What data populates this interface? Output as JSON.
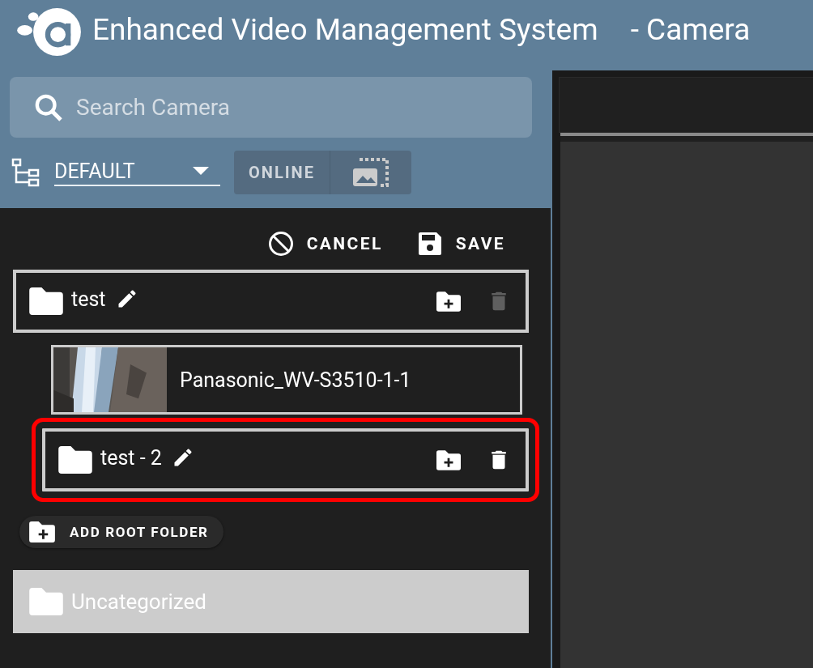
{
  "app": {
    "title": "Enhanced Video Management System",
    "page": "- Camera"
  },
  "search": {
    "placeholder": "Search Camera"
  },
  "layout_select": {
    "value": "DEFAULT"
  },
  "filters": [
    {
      "kind": "text",
      "label": "ONLINE"
    },
    {
      "kind": "icon"
    }
  ],
  "actions": [
    {
      "kind": "cancel",
      "label": "CANCEL"
    },
    {
      "kind": "save",
      "label": "SAVE"
    }
  ],
  "tree": [
    {
      "kind": "folder",
      "label": "test",
      "selected": false,
      "delete_disabled": true,
      "children": [
        {
          "kind": "camera",
          "label": "Panasonic_WV-S3510-1-1"
        },
        {
          "kind": "folder",
          "label": "test - 2",
          "selected": true,
          "delete_disabled": false
        }
      ]
    }
  ],
  "add_root": {
    "label": "ADD ROOT FOLDER"
  },
  "uncategorized": {
    "label": "Uncategorized"
  }
}
